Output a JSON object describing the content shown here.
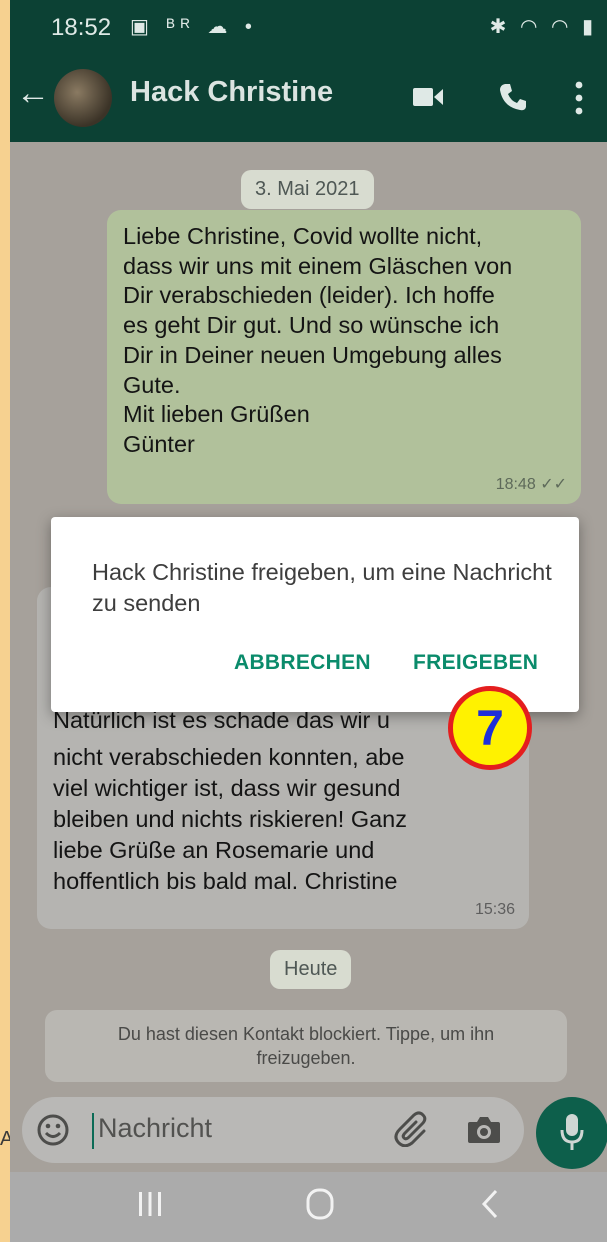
{
  "status_bar": {
    "time": "18:52",
    "left_icons": "▣ ᴮᴿ ☁ •",
    "right_icons": "✱ ◠ ◠ ▮"
  },
  "header": {
    "back_icon": "arrow-left-icon",
    "contact_name": "Hack Christine",
    "actions": [
      "video-call-icon",
      "phone-icon",
      "more-vert-icon"
    ]
  },
  "chat": {
    "date_chip_1": "3. Mai 2021",
    "outgoing_message": {
      "text": "Liebe Christine, Covid wollte nicht,\ndass wir uns mit einem Gläschen von\nDir verabschieden (leider). Ich hoffe\nes geht Dir gut. Und so wünsche ich\nDir in Deiner neuen Umgebung alles\nGute.\nMit lieben Grüßen\nGünter",
      "time": "18:48",
      "status": "✓✓"
    },
    "incoming_message": {
      "partial_line": "Natürlich ist es schade das wir u",
      "text": "nicht verabschieden konnten, abe\nviel wichtiger ist, dass wir gesund\nbleiben und nichts riskieren! Ganz\nliebe Grüße an Rosemarie und\nhoffentlich bis bald mal. Christine",
      "time": "15:36"
    },
    "date_chip_2": "Heute",
    "system_note": "Du hast diesen Kontakt blockiert. Tippe, um ihn\nfreizugeben."
  },
  "input": {
    "placeholder": "Nachricht",
    "icons": [
      "emoji-icon",
      "attach-icon",
      "camera-icon",
      "mic-icon"
    ]
  },
  "dialog": {
    "message": "Hack Christine freigeben, um eine Nachricht zu senden",
    "cancel_label": "ABBRECHEN",
    "confirm_label": "FREIGEBEN"
  },
  "annotation": {
    "step_number": "7",
    "left_edge_text": "A"
  },
  "colors": {
    "frame": "#f6d190",
    "accent": "#0a8b6b",
    "badge_fill": "#fff200",
    "badge_border": "#e41e1e",
    "badge_text": "#1e2fd9"
  }
}
